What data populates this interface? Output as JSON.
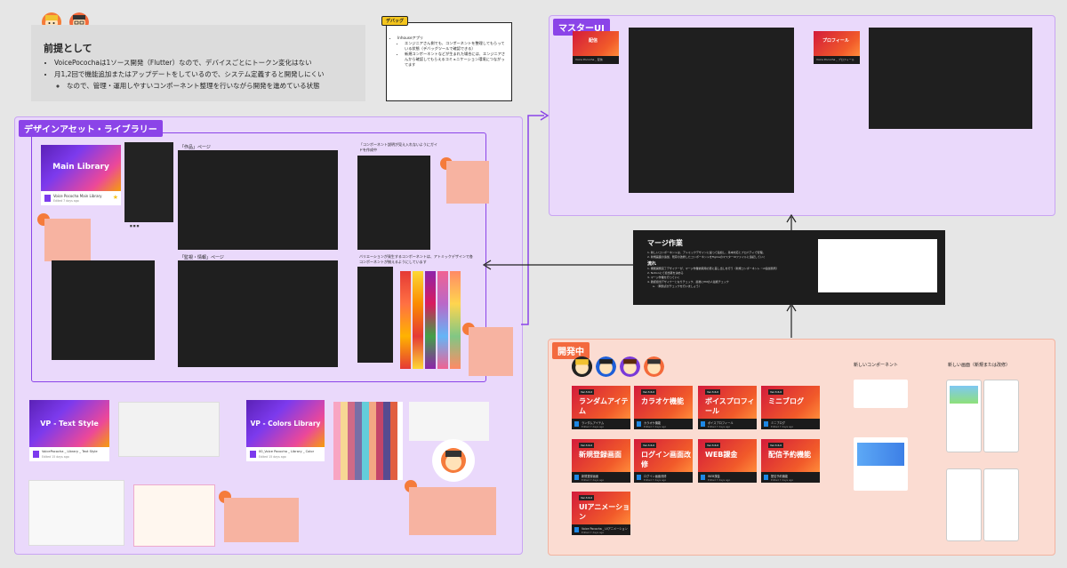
{
  "premise": {
    "title": "前提として",
    "bullets": [
      "VoicePocochaは1ソース開発（Flutter）なので、デバイスごとにトークン変化はない",
      "月1,2回で機能追加またはアップデートをしているので、システム定義すると開発しにくい"
    ],
    "sub_bullet": "なので、管理・運用しやすいコンポーネント整理を行いながら開発を進めている状態"
  },
  "debug": {
    "tag": "デバッグ",
    "item": "Inhouseアプリ",
    "sub_items": [
      "エンジニアさん側でも、コンポーネントを整理してもらっている状態（デバッグツールで確認できる）",
      "新規コンポーネントなどが生まれた場合には、エンジニアさんから確認してもらえるコミュニケーション環境につながってます"
    ]
  },
  "design_assets": {
    "tag": "デザインアセット・ライブラリー",
    "main_library": {
      "thumb_title": "Main Library",
      "name": "Voice Pococha Main Library",
      "edited": "Edited 7 days ago"
    },
    "text_style": {
      "thumb_title": "VP - Text Style",
      "name": "VoicePococha _ Library _ Text Style",
      "edited": "Edited 15 days ago"
    },
    "colors_library": {
      "thumb_title": "VP - Colors Library",
      "name": "00_Voice Pococha _ Library _ Color",
      "edited": "Edited 15 days ago"
    },
    "board_top_left": "「作品」ページ",
    "board_bottom_left": "「監視・情報」ページ",
    "board_top_right": "「コンポーネント説明が見え入れないようにガイドを作成中",
    "board_bottom_right": "バリエーションが発生するコンポーネントは、アトミックデザインで各コンポーネントが揃えるようにしています"
  },
  "master_ui": {
    "tag": "マスターUI",
    "card1_title": "配信",
    "card1_name": "Voice Pococha _ 配信",
    "card2_title": "プロフィール",
    "card2_name": "Voice Pococha _ プロフィール"
  },
  "merge": {
    "title": "マージ作業",
    "lines_top": [
      "1. 新しいコンポーネントは、アトミックデザインに従って追加し、基本対応とプロパティで管理。",
      "2. 新規画面の追加、既存の改修したコンポーネントをFigmaのマスターUIファイルに追記していく"
    ],
    "flow_title": "流れ",
    "lines_flow": [
      "1. 機能開発完了デザイナーが、マージ作業依頼用の頁に差し出しを行う（新規コンポーネント・UI追加箇所）",
      "2. Notionにて担当者を決める",
      "3. マージ作業を行っていく",
      "4. 確認担当デザイナーとなりチェック、最後にPMの人最終チェック",
      "a. （問題点がチェックを行いましょう）"
    ]
  },
  "dev": {
    "tag": "開発中",
    "new_component": "新しいコンポーネント",
    "new_screen": "新しい画面（新規または改修）",
    "cards": [
      {
        "version": "Ver.3.6.0",
        "label": "ランダムアイテム",
        "name": "ランダムアイテム"
      },
      {
        "version": "Ver.3.6.0",
        "label": "カラオケ機能",
        "name": "カラオケ機能"
      },
      {
        "version": "Ver.3.6.0",
        "label": "ボイスプロフィール",
        "name": "ボイスプロフィール"
      },
      {
        "version": "Ver.3.6.0",
        "label": "ミニブログ",
        "name": "ミニブログ"
      },
      {
        "version": "Ver.3.6.0",
        "label": "新規登録画面",
        "name": "新規登録画面"
      },
      {
        "version": "Ver.3.6.0",
        "label": "ログイン画面改修",
        "name": "ログイン画面改修"
      },
      {
        "version": "Ver.3.6.0",
        "label": "WEB課金",
        "name": "WEB課金"
      },
      {
        "version": "Ver.3.6.0",
        "label": "配信予約機能",
        "name": "配信予約機能"
      },
      {
        "version": "Ver.3.6.0",
        "label": "UIアニメーション",
        "name": "Voice Pococha _ UIアニメーション"
      }
    ],
    "edited": "Edited 7 days ago"
  },
  "colors": {
    "purple_tag": "#8b44e8",
    "purple_bg": "#ead9fb",
    "salmon_bg": "#fbdcd2",
    "salmon_tag": "#f36a3f",
    "debug_tag": "#f4c51d",
    "note_bg": "#f7b3a1"
  }
}
